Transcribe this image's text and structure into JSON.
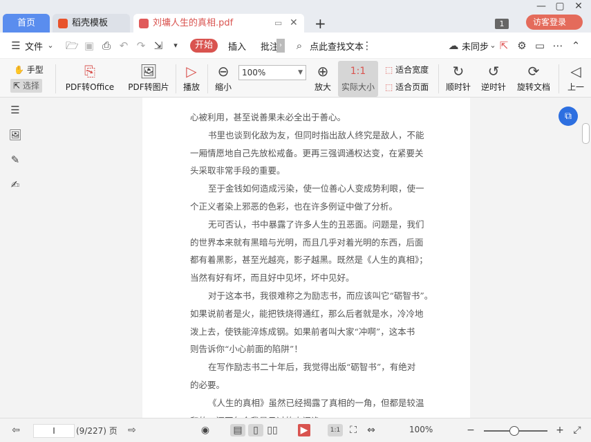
{
  "tabs": {
    "home": "首页",
    "template": "稻壳模板",
    "document": "刘墉人生的真相.pdf",
    "window_count": "1",
    "login": "访客登录"
  },
  "menu": {
    "file": "文件",
    "start": "开始",
    "insert": "插入",
    "annotate": "批注",
    "search": "点此查找文本",
    "sync": "未同步"
  },
  "ribbon": {
    "hand": "手型",
    "select": "选择",
    "pdf_to_office": "PDF转Office",
    "pdf_to_image": "PDF转图片",
    "play": "播放",
    "zoom_out": "缩小",
    "zoom_value": "100%",
    "zoom_in": "放大",
    "actual_size": "实际大小",
    "fit_width": "适合宽度",
    "fit_page": "适合页面",
    "rotate_cw": "顺时针",
    "rotate_ccw": "逆时针",
    "rotate_doc": "旋转文档",
    "prev": "上一"
  },
  "document_lines": [
    "心被利用，甚至说善果未必全出于善心。",
    "书里也谈到化敌为友，但同时指出敌人终究是敌人，不能",
    "一厢情愿地自己先放松戒备。更再三强调通权达变，在紧要关",
    "头采取非常手段的重要。",
    "至于金钱如何造成污染，使一位善心人变成势利眼，使一",
    "个正义者染上邪恶的色彩，也在许多例证中做了分析。",
    "无可否认，书中暴露了许多人生的丑恶面。问题是，我们",
    "的世界本来就有黑暗与光明，而且几乎对着光明的东西，后面",
    "都有着黑影，甚至光越亮，影子越黑。既然是《人生的真相》；",
    "当然有好有坏，而且好中见坏，坏中见好。",
    "对于这本书，我很难称之为励志书，而应该叫它“砺智书”。",
    "如果说前者是火，能把铁烧得通红，那么后者就是水，冷冷地",
    "泼上去，使铁能淬炼成钢。如果前者叫大家“冲啊”，这本书",
    "则告诉你“小心前面的陷阱”！",
    "在写作励志书二十年后，我觉得出版“砺智书”，有绝对",
    "的必要。",
    "《人生的真相》虽然已经揭露了真相的一角，但都是较温",
    "和的，还不包含我最见过的人间诡"
  ],
  "status": {
    "page_input": "I",
    "page_info": "(9/227) 页",
    "zoom": "100%"
  }
}
